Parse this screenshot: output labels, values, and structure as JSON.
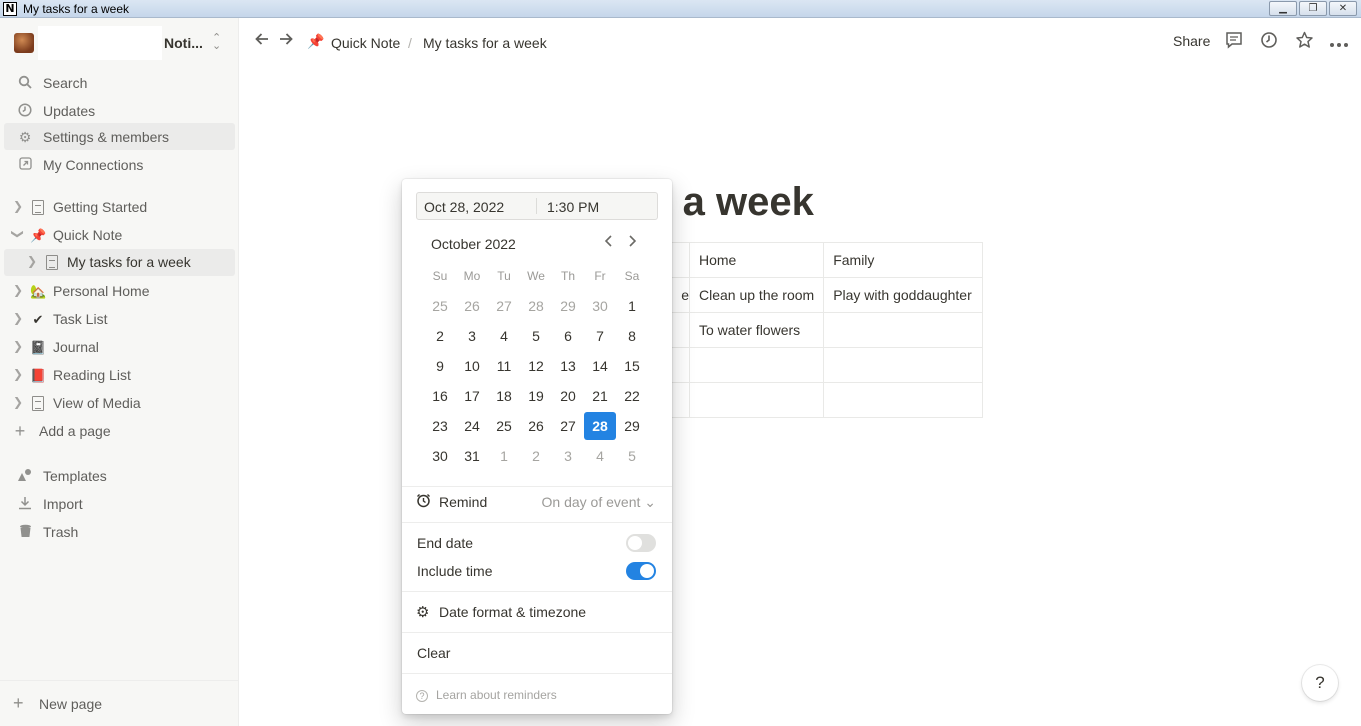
{
  "window": {
    "title": "My tasks for a week",
    "controls": [
      "▁",
      "❐",
      "✕"
    ]
  },
  "sidebar": {
    "workspace_name": "Noti...",
    "nav": [
      {
        "label": "Search",
        "icon": "search-icon"
      },
      {
        "label": "Updates",
        "icon": "clock-icon"
      },
      {
        "label": "Settings & members",
        "icon": "gear-icon"
      },
      {
        "label": "My Connections",
        "icon": "link-box-icon"
      }
    ],
    "pages": [
      {
        "label": "Getting Started",
        "icon": "document-icon"
      },
      {
        "label": "Quick Note",
        "icon": "pushpin-icon",
        "glyph": "📌"
      },
      {
        "label": "My tasks for a week",
        "icon": "document-icon"
      },
      {
        "label": "Personal Home",
        "icon": "house-icon",
        "glyph": "🏡"
      },
      {
        "label": "Task List",
        "icon": "checkmark-icon",
        "glyph": "✔"
      },
      {
        "label": "Journal",
        "icon": "notebook-icon",
        "glyph": "📓"
      },
      {
        "label": "Reading List",
        "icon": "red-book-icon",
        "glyph": "📕"
      },
      {
        "label": "View of Media",
        "icon": "document-link-icon"
      }
    ],
    "add_page": "Add a page",
    "tools": [
      {
        "label": "Templates",
        "icon": "shapes-icon"
      },
      {
        "label": "Import",
        "icon": "download-icon"
      },
      {
        "label": "Trash",
        "icon": "trash-icon"
      }
    ],
    "new_page": "New page"
  },
  "topbar": {
    "breadcrumb_parent": "Quick Note",
    "breadcrumb_sep": "/",
    "breadcrumb_current": "My tasks for a week",
    "share": "Share"
  },
  "page": {
    "title_visible": "r a week",
    "table": {
      "rows": [
        [
          "",
          "Home",
          "Family"
        ],
        [
          "e",
          "Clean up the room",
          "Play with goddaughter"
        ],
        [
          "",
          "To water flowers",
          ""
        ],
        [
          "",
          "",
          ""
        ],
        [
          "",
          "",
          ""
        ]
      ]
    }
  },
  "datepicker": {
    "date_value": "Oct 28, 2022",
    "time_value": "1:30 PM",
    "month_label": "October 2022",
    "weekdays": [
      "Su",
      "Mo",
      "Tu",
      "We",
      "Th",
      "Fr",
      "Sa"
    ],
    "weeks": [
      [
        25,
        26,
        27,
        28,
        29,
        30,
        1
      ],
      [
        2,
        3,
        4,
        5,
        6,
        7,
        8
      ],
      [
        9,
        10,
        11,
        12,
        13,
        14,
        15
      ],
      [
        16,
        17,
        18,
        19,
        20,
        21,
        22
      ],
      [
        23,
        24,
        25,
        26,
        27,
        28,
        29
      ],
      [
        30,
        31,
        1,
        2,
        3,
        4,
        5
      ]
    ],
    "selected_day": 28,
    "remind_label": "Remind",
    "remind_value": "On day of event",
    "end_date_label": "End date",
    "end_date_on": false,
    "include_time_label": "Include time",
    "include_time_on": true,
    "date_format_label": "Date format & timezone",
    "clear_label": "Clear",
    "learn_label": "Learn about reminders"
  },
  "help_label": "?",
  "colors": {
    "accent": "#2383e2",
    "sidebar_bg": "#f7f7f5",
    "text": "#37352f"
  }
}
